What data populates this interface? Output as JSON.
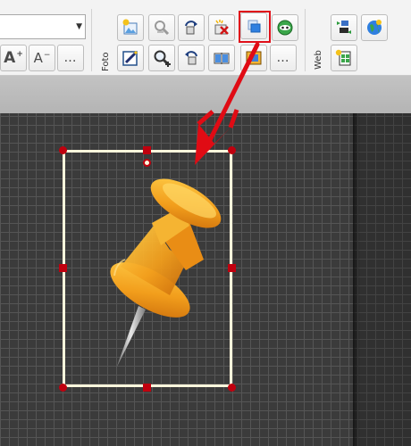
{
  "toolbar": {
    "groups": [
      {
        "label": "Foto"
      },
      {
        "label": "Web"
      }
    ],
    "font_size_up_label": "A",
    "font_size_up_sup": "+",
    "font_size_down_label": "A",
    "font_size_down_sup": "−",
    "more_label": "…",
    "highlighted_button": "bring-to-front"
  },
  "colors": {
    "selection_handle": "#c0000e",
    "annotation": "#e0101a",
    "frame": "#fff7dc",
    "pin": "#f0a020"
  }
}
